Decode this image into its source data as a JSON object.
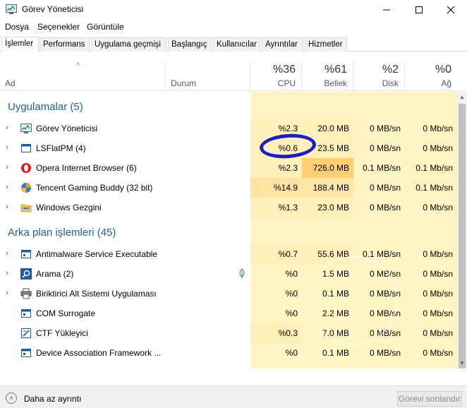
{
  "window": {
    "title": "Görev Yöneticisi"
  },
  "menu": {
    "items": [
      {
        "label": "Dosya"
      },
      {
        "label": "Seçenekler"
      },
      {
        "label": "Görüntüle"
      }
    ]
  },
  "tabs": [
    {
      "label": "İşlemler",
      "active": true
    },
    {
      "label": "Performans",
      "active": false
    },
    {
      "label": "Uygulama geçmişi",
      "active": false
    },
    {
      "label": "Başlangıç",
      "active": false
    },
    {
      "label": "Kullanıcılar",
      "active": false
    },
    {
      "label": "Ayrıntılar",
      "active": false
    },
    {
      "label": "Hizmetler",
      "active": false
    }
  ],
  "columns": {
    "name": "Ad",
    "status": "Durum",
    "cpu": {
      "percent": "%36",
      "label": "CPU"
    },
    "memory": {
      "percent": "%61",
      "label": "Bellek"
    },
    "disk": {
      "percent": "%2",
      "label": "Disk"
    },
    "network": {
      "percent": "%0",
      "label": "Ağ"
    }
  },
  "sections": {
    "apps": "Uygulamalar (5)",
    "background": "Arka plan işlemleri (45)"
  },
  "apps": [
    {
      "name": "Görev Yöneticisi",
      "icon": "task-manager-icon",
      "cpu": "%2.3",
      "mem": "20.0 MB",
      "disk": "0 MB/sn",
      "net": "0 Mb/sn"
    },
    {
      "name": "LSFlatPM (4)",
      "icon": "window-app-icon",
      "cpu": "%0.6",
      "mem": "23.5 MB",
      "disk": "0 MB/sn",
      "net": "0 Mb/sn"
    },
    {
      "name": "Opera Internet Browser (6)",
      "icon": "opera-icon",
      "cpu": "%2.3",
      "mem": "726.0 MB",
      "disk": "0.1 MB/sn",
      "net": "0.1 Mb/sn"
    },
    {
      "name": "Tencent Gaming Buddy (32 bit)",
      "icon": "tencent-icon",
      "cpu": "%14.9",
      "mem": "188.4 MB",
      "disk": "0 MB/sn",
      "net": "0.1 Mb/sn"
    },
    {
      "name": "Windows Gezgini",
      "icon": "folder-icon",
      "cpu": "%1.3",
      "mem": "23.0 MB",
      "disk": "0 MB/sn",
      "net": "0 Mb/sn"
    }
  ],
  "background": [
    {
      "name": "Antimalware Service Executable",
      "icon": "service-window-icon",
      "cpu": "%0.7",
      "mem": "55.6 MB",
      "disk": "0.1 MB/sn",
      "net": "0 Mb/sn"
    },
    {
      "name": "Arama (2)",
      "icon": "search-icon",
      "cpu": "%0",
      "mem": "1.5 MB",
      "disk": "0 MB/sn",
      "net": "0 Mb/sn"
    },
    {
      "name": "Biriktirici Alt Sistemi Uygulaması",
      "icon": "printer-icon",
      "cpu": "%0",
      "mem": "0.1 MB",
      "disk": "0 MB/sn",
      "net": "0 Mb/sn"
    },
    {
      "name": "COM Surrogate",
      "icon": "service-window-icon",
      "cpu": "%0",
      "mem": "2.2 MB",
      "disk": "0 MB/sn",
      "net": "0 Mb/sn"
    },
    {
      "name": "CTF Yükleyici",
      "icon": "ctf-icon",
      "cpu": "%0.3",
      "mem": "7.0 MB",
      "disk": "0 MB/sn",
      "net": "0 Mb/sn"
    },
    {
      "name": "Device Association Framework ...",
      "icon": "service-window-icon",
      "cpu": "%0",
      "mem": "0.1 MB",
      "disk": "0 MB/sn",
      "net": "0 Mb/sn"
    }
  ],
  "footer": {
    "fewer_details": "Daha az ayrıntı",
    "end_task": "Görevi sonlandır"
  },
  "colors": {
    "section_blue": "#1f5fa8",
    "heat_light": "#fff4c4",
    "heat_medium": "#ffe8a8",
    "heat_strong": "#ffd27a",
    "annotation_ring": "#1c1ccc"
  }
}
